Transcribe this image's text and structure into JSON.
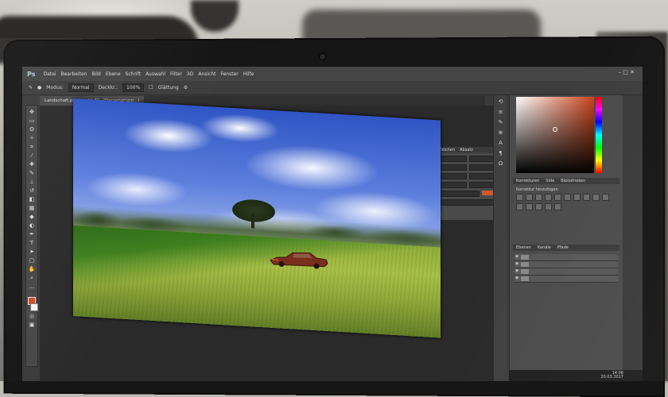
{
  "scene": "photo of a laptop on a desk showing Adobe Photoshop",
  "app": {
    "logo": "Ps",
    "menu": [
      "Datei",
      "Bearbeiten",
      "Bild",
      "Ebene",
      "Schrift",
      "Auswahl",
      "Filter",
      "3D",
      "Ansicht",
      "Fenster",
      "Hilfe"
    ],
    "window_controls": "–  □  ✕"
  },
  "options_bar": {
    "mode_label": "Modus:",
    "mode_value": "Normal",
    "opacity_label": "Deckkr.:",
    "opacity_value": "100%",
    "smooth_label": "Glättung"
  },
  "document": {
    "tab_label": "Landschaft.psd bei 16,7% (Ebenengrupp...)"
  },
  "panels": {
    "character": {
      "tabs": [
        "Zeichen",
        "Absatz"
      ],
      "color": "#cf5a2a"
    },
    "adjustments": {
      "tabs": [
        "Korrekturen",
        "Stile",
        "Bibliotheken"
      ],
      "label": "Korrektur hinzufügen"
    },
    "layers": {
      "tabs": [
        "Ebenen",
        "Kanäle",
        "Pfade"
      ],
      "rows": 4
    }
  },
  "color_picker": {
    "selected_hue": "#c9431b"
  },
  "taskbar": {
    "time": "14:06",
    "date": "20.03.2017"
  },
  "photo": {
    "subject": "blue cloudy sky over a green field with a lone tree and an old rusty car"
  }
}
